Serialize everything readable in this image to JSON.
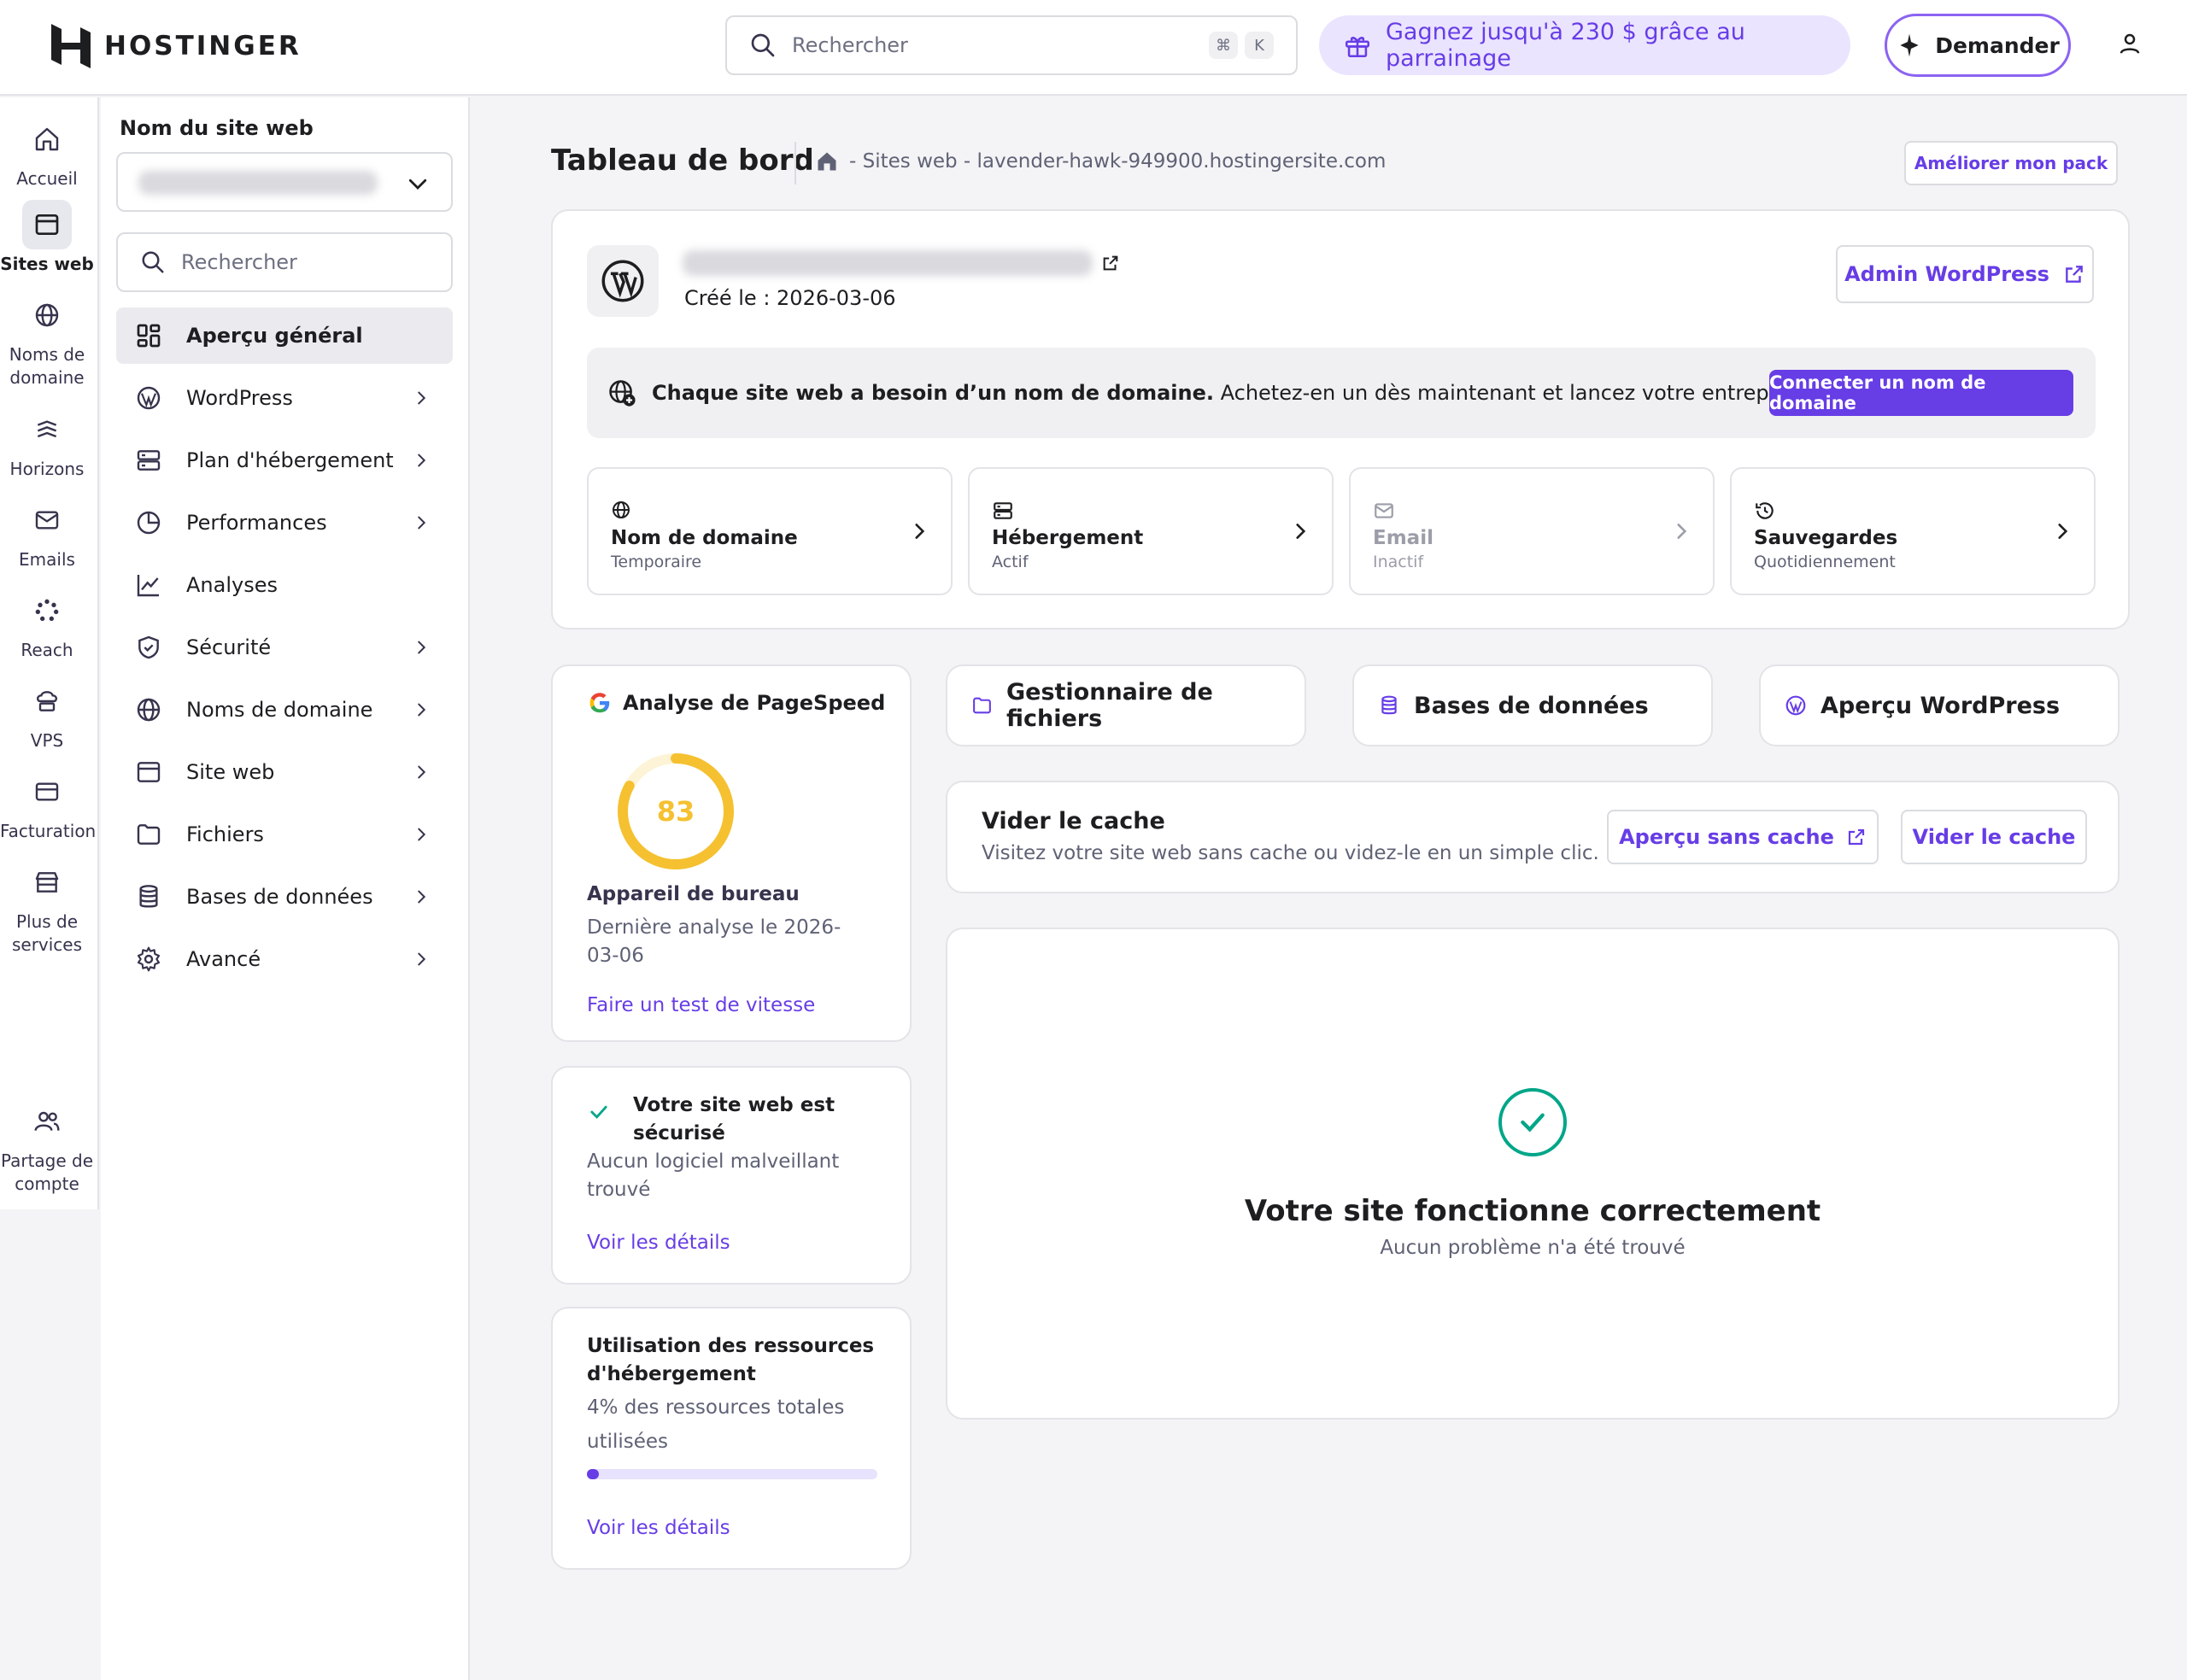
{
  "header": {
    "logo_text": "HOSTINGER",
    "search_placeholder": "Rechercher",
    "shortcut_keys": [
      "⌘",
      "K"
    ],
    "referral_text": "Gagnez jusqu'à 230 $ grâce au parrainage",
    "ask_button": "Demander"
  },
  "rail": {
    "items": [
      {
        "label": "Accueil",
        "icon": "home-icon"
      },
      {
        "label": "Sites web",
        "icon": "browser-icon"
      },
      {
        "label": "Noms de domaine",
        "icon": "globe-icon"
      },
      {
        "label": "Horizons",
        "icon": "horizons-icon"
      },
      {
        "label": "Emails",
        "icon": "mail-icon"
      },
      {
        "label": "Reach",
        "icon": "reach-icon"
      },
      {
        "label": "VPS",
        "icon": "cloud-server-icon"
      },
      {
        "label": "Facturation",
        "icon": "card-icon"
      },
      {
        "label": "Plus de services",
        "icon": "store-icon"
      },
      {
        "label": "Partage de compte",
        "icon": "users-icon"
      }
    ]
  },
  "nav": {
    "title": "Nom du site web",
    "search_placeholder": "Rechercher",
    "items": [
      {
        "label": "Aperçu général",
        "icon": "dashboard-icon"
      },
      {
        "label": "WordPress",
        "icon": "wordpress-icon"
      },
      {
        "label": "Plan d'hébergement",
        "icon": "server-icon"
      },
      {
        "label": "Performances",
        "icon": "pie-chart-icon"
      },
      {
        "label": "Analyses",
        "icon": "trend-icon"
      },
      {
        "label": "Sécurité",
        "icon": "shield-icon"
      },
      {
        "label": "Noms de domaine",
        "icon": "globe-icon"
      },
      {
        "label": "Site web",
        "icon": "browser-icon"
      },
      {
        "label": "Fichiers",
        "icon": "folder-icon"
      },
      {
        "label": "Bases de données",
        "icon": "database-icon"
      },
      {
        "label": "Avancé",
        "icon": "gear-icon"
      }
    ]
  },
  "main": {
    "title": "Tableau de bord",
    "breadcrumb": "- Sites web - lavender-hawk-949900.hostingersite.com",
    "upgrade_button": "Améliorer mon pack",
    "site": {
      "created": "Créé le : 2026-03-06",
      "admin_button": "Admin WordPress"
    },
    "domain_banner": {
      "bold": "Chaque site web a besoin d’un nom de domaine.",
      "text": " Achetez-en un dès maintenant et lancez votre entreprise.",
      "button": "Connecter un nom de domaine"
    },
    "status_cards": [
      {
        "label": "Nom de domaine",
        "sub": "Temporaire",
        "icon": "globe-icon"
      },
      {
        "label": "Hébergement",
        "sub": "Actif",
        "icon": "server-icon"
      },
      {
        "label": "Email",
        "sub": "Inactif",
        "icon": "mail-icon"
      },
      {
        "label": "Sauvegardes",
        "sub": "Quotidiennement",
        "icon": "history-icon"
      }
    ],
    "pagespeed": {
      "title": "Analyse de PageSpeed",
      "score": "83",
      "score_fraction": 0.83,
      "device": "Appareil de bureau",
      "last": "Dernière analyse le 2026-03-06",
      "link": "Faire un test de vitesse"
    },
    "security": {
      "title": "Votre site web est sécurisé",
      "sub": "Aucun logiciel malveillant trouvé",
      "link": "Voir les détails"
    },
    "resources": {
      "title": "Utilisation des ressources d'hébergement",
      "sub": "4% des ressources totales utilisées",
      "usage_fraction": 0.04,
      "link": "Voir les détails"
    },
    "tools": [
      {
        "label": "Gestionnaire de fichiers",
        "icon": "folder-icon"
      },
      {
        "label": "Bases de données",
        "icon": "database-icon"
      },
      {
        "label": "Aperçu WordPress",
        "icon": "wordpress-icon"
      }
    ],
    "cache": {
      "title": "Vider le cache",
      "sub": "Visitez votre site web sans cache ou videz-le en un simple clic.",
      "preview_button": "Aperçu sans cache",
      "clear_button": "Vider le cache"
    },
    "health": {
      "title": "Votre site fonctionne correctement",
      "sub": "Aucun problème n'a été trouvé"
    }
  },
  "colors": {
    "accent": "#673de6",
    "success": "#00a688",
    "score": "#f5c131"
  }
}
